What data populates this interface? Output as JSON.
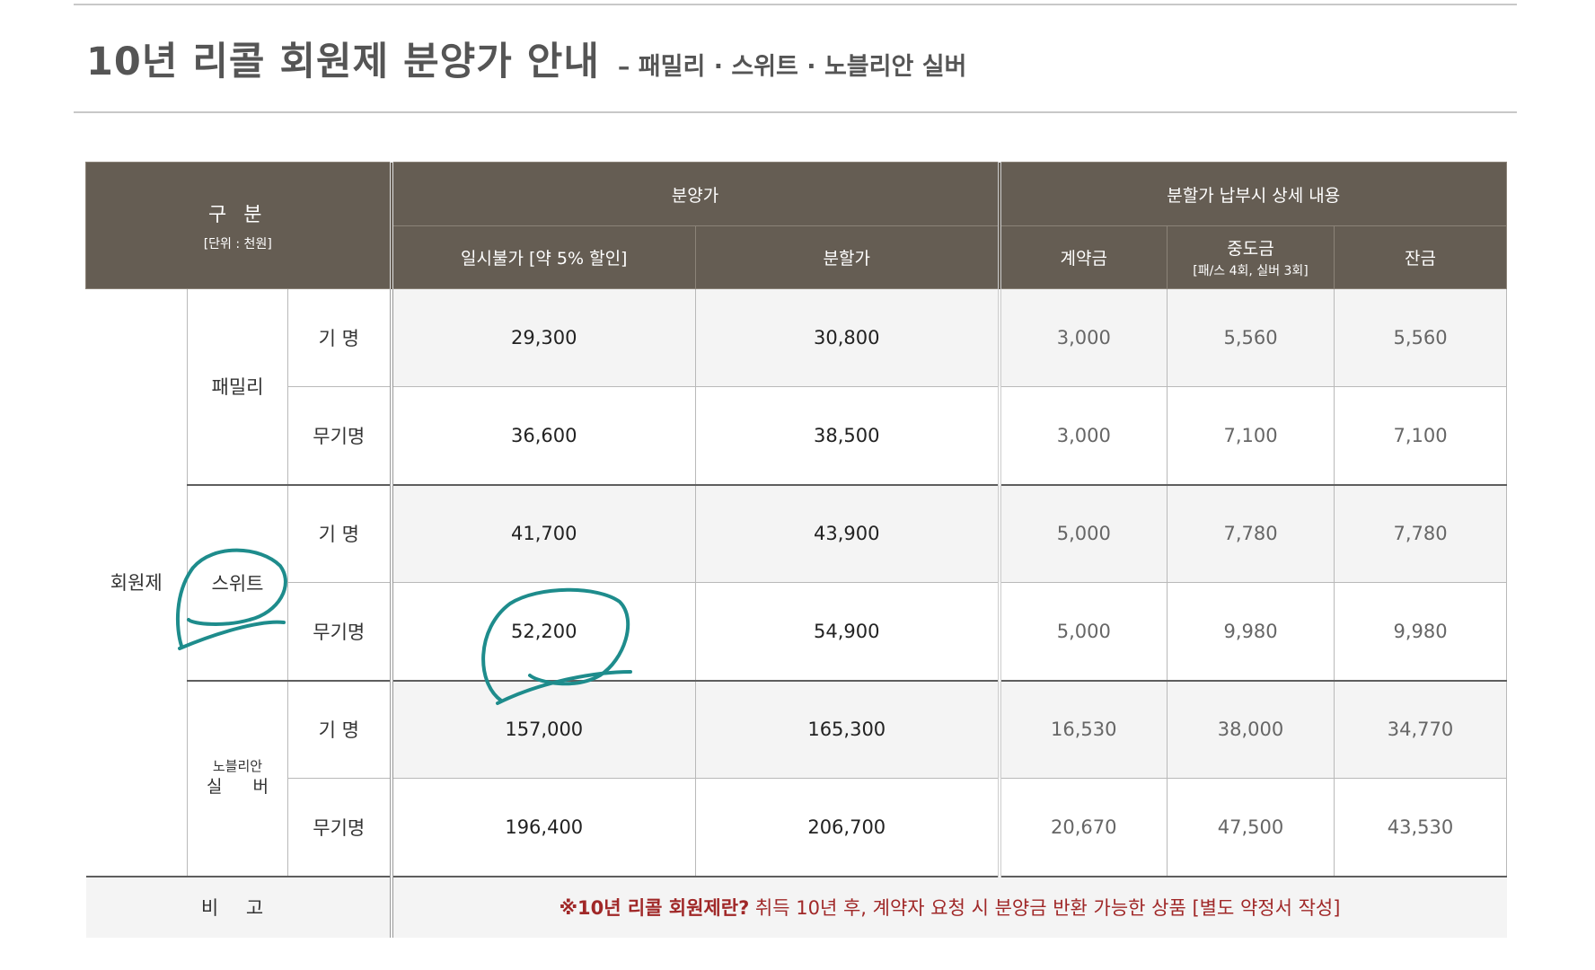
{
  "title": {
    "main": "10년 리콜 회원제 분양가 안내",
    "sub": "– 패밀리 · 스위트 · 노블리안 실버"
  },
  "header": {
    "gubun": "구 분",
    "unit": "[단위 : 천원]",
    "price_group": "분양가",
    "installment_group": "분할가 납부시 상세 내용",
    "lump_sum": "일시불가 [약 5% 할인]",
    "installment": "분할가",
    "deposit": "계약금",
    "middle": "중도금",
    "middle_note": "[패/스 4회, 실버 3회]",
    "balance": "잔금"
  },
  "membership_label": "회원제",
  "groups": [
    {
      "name": "패밀리",
      "rows": [
        {
          "type": "기 명",
          "lump_sum": "29,300",
          "installment": "30,800",
          "deposit": "3,000",
          "middle": "5,560",
          "balance": "5,560"
        },
        {
          "type": "무기명",
          "lump_sum": "36,600",
          "installment": "38,500",
          "deposit": "3,000",
          "middle": "7,100",
          "balance": "7,100"
        }
      ]
    },
    {
      "name": "스위트",
      "rows": [
        {
          "type": "기 명",
          "lump_sum": "41,700",
          "installment": "43,900",
          "deposit": "5,000",
          "middle": "7,780",
          "balance": "7,780"
        },
        {
          "type": "무기명",
          "lump_sum": "52,200",
          "installment": "54,900",
          "deposit": "5,000",
          "middle": "9,980",
          "balance": "9,980"
        }
      ]
    },
    {
      "name_small": "노블리안",
      "name_big": "실 버",
      "rows": [
        {
          "type": "기 명",
          "lump_sum": "157,000",
          "installment": "165,300",
          "deposit": "16,530",
          "middle": "38,000",
          "balance": "34,770"
        },
        {
          "type": "무기명",
          "lump_sum": "196,400",
          "installment": "206,700",
          "deposit": "20,670",
          "middle": "47,500",
          "balance": "43,530"
        }
      ]
    }
  ],
  "remark": {
    "label": "비 고",
    "strong": "※10년 리콜 회원제란?",
    "text": " 취득 10년 후, 계약자 요청 시 분양금 반환 가능한 상품 [별도 약정서 작성]"
  },
  "colors": {
    "header_bg": "#655d53",
    "annotation": "#1e8c8c",
    "remark_text": "#a02828"
  }
}
